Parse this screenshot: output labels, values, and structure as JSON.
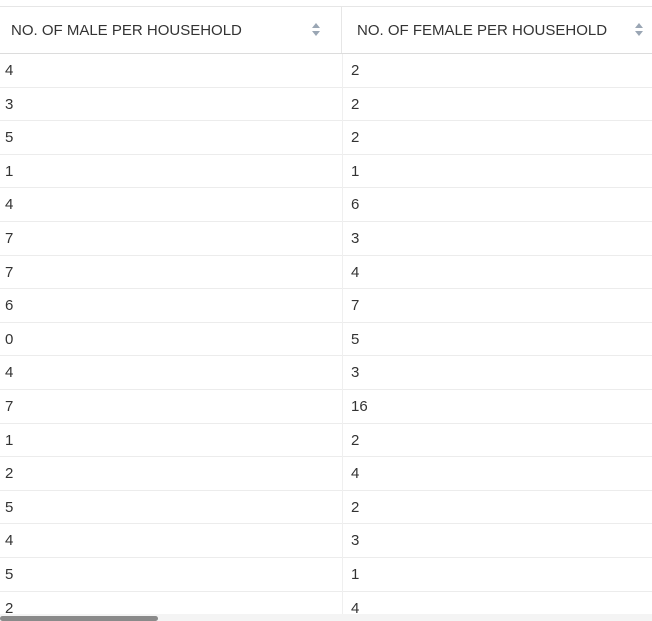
{
  "table": {
    "columns": [
      {
        "label": "NO. OF MALE PER HOUSEHOLD",
        "sort_icon": "sort-both-icon"
      },
      {
        "label": "NO. OF FEMALE PER HOUSEHOLD",
        "sort_icon": "sort-both-icon"
      }
    ],
    "rows": [
      [
        "4",
        "2"
      ],
      [
        "3",
        "2"
      ],
      [
        "5",
        "2"
      ],
      [
        "1",
        "1"
      ],
      [
        "4",
        "6"
      ],
      [
        "7",
        "3"
      ],
      [
        "7",
        "4"
      ],
      [
        "6",
        "7"
      ],
      [
        "0",
        "5"
      ],
      [
        "4",
        "3"
      ],
      [
        "7",
        "16"
      ],
      [
        "1",
        "2"
      ],
      [
        "2",
        "4"
      ],
      [
        "5",
        "2"
      ],
      [
        "4",
        "3"
      ],
      [
        "5",
        "1"
      ],
      [
        "2",
        "4"
      ]
    ]
  },
  "colors": {
    "text": "#333333",
    "sort_icon": "#9aa6b4",
    "row_border": "#ececec",
    "scrollbar_thumb": "#8a8a8a"
  }
}
